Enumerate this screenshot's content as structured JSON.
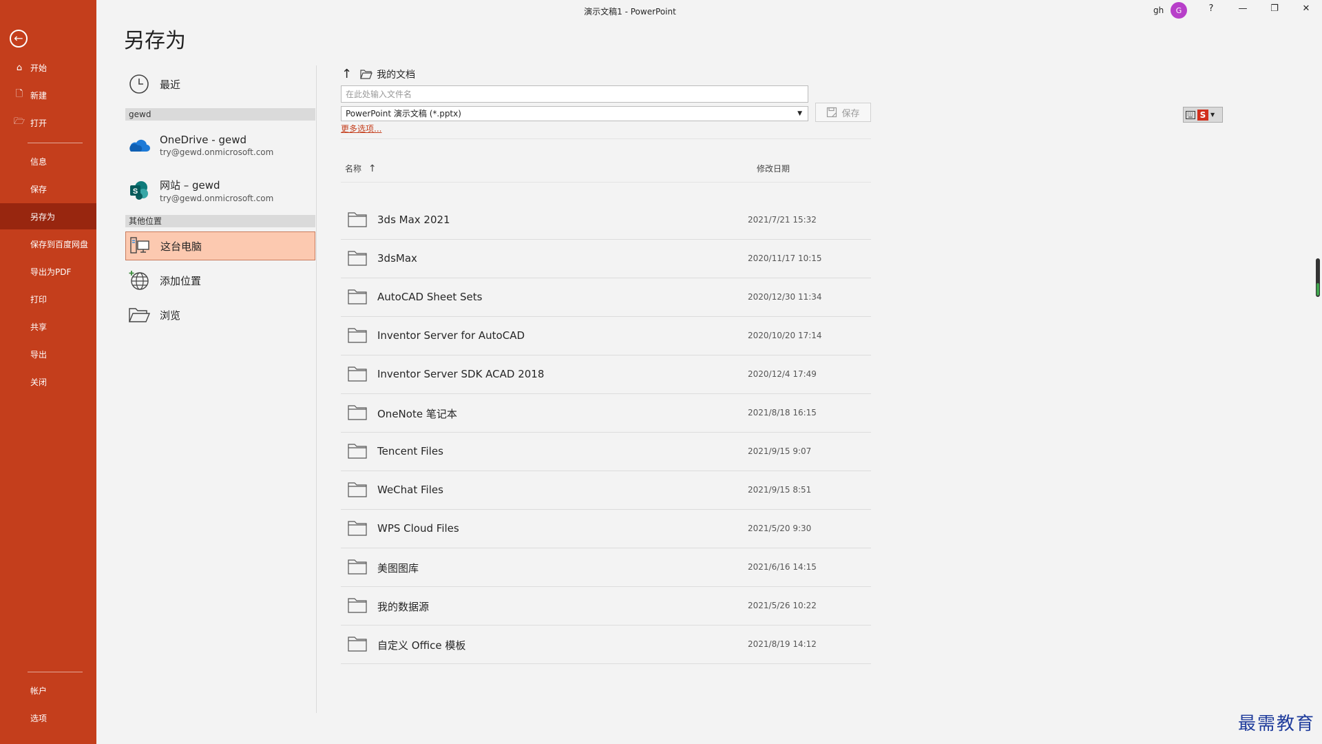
{
  "window": {
    "title": "演示文稿1  -  PowerPoint",
    "user": "gh",
    "avatar_letter": "G",
    "help": "?",
    "minimize": "—",
    "restore": "❐",
    "close": "✕"
  },
  "sidebar": {
    "back": "←",
    "top_items": [
      {
        "label": "开始",
        "icon": "⌂"
      },
      {
        "label": "新建",
        "icon": "🗋"
      },
      {
        "label": "打开",
        "icon": "🗁"
      }
    ],
    "items": [
      "信息",
      "保存",
      "另存为",
      "保存到百度网盘",
      "导出为PDF",
      "打印",
      "共享",
      "导出",
      "关闭"
    ],
    "active": "另存为",
    "bottom_items": [
      "帐户",
      "选项"
    ]
  },
  "page": {
    "title": "另存为"
  },
  "locations": {
    "recent": "最近",
    "group1": "gewd",
    "onedrive": {
      "label": "OneDrive - gewd",
      "email": "try@gewd.onmicrosoft.com"
    },
    "site": {
      "label": "网站 – gewd",
      "email": "try@gewd.onmicrosoft.com",
      "badge": "S"
    },
    "group2": "其他位置",
    "this_pc": "这台电脑",
    "add_place": "添加位置",
    "browse": "浏览"
  },
  "file_panel": {
    "up": "↑",
    "current_folder": "我的文档",
    "filename_placeholder": "在此处输入文件名",
    "file_type": "PowerPoint 演示文稿 (*.pptx)",
    "save_label": "保存",
    "more_options": "更多选项...",
    "col_name": "名称",
    "sort_arrow": "↑",
    "col_date": "修改日期",
    "files": [
      {
        "name": "3ds Max 2021",
        "date": "2021/7/21 15:32"
      },
      {
        "name": "3dsMax",
        "date": "2020/11/17 10:15"
      },
      {
        "name": "AutoCAD Sheet Sets",
        "date": "2020/12/30 11:34"
      },
      {
        "name": "Inventor Server for AutoCAD",
        "date": "2020/10/20 17:14"
      },
      {
        "name": "Inventor Server SDK ACAD 2018",
        "date": "2020/12/4 17:49"
      },
      {
        "name": "OneNote 笔记本",
        "date": "2021/8/18 16:15"
      },
      {
        "name": "Tencent Files",
        "date": "2021/9/15 9:07"
      },
      {
        "name": "WeChat Files",
        "date": "2021/9/15 8:51"
      },
      {
        "name": "WPS Cloud Files",
        "date": "2021/5/20 9:30"
      },
      {
        "name": "美图图库",
        "date": "2021/6/16 14:15"
      },
      {
        "name": "我的数据源",
        "date": "2021/5/26 10:22"
      },
      {
        "name": "自定义 Office 模板",
        "date": "2021/8/19 14:12"
      }
    ]
  },
  "ime": {
    "logo": "S"
  },
  "watermark": "最需教育",
  "colors": {
    "accent": "#c43e1c",
    "active": "#98260f",
    "selected": "#fcc9b0"
  }
}
